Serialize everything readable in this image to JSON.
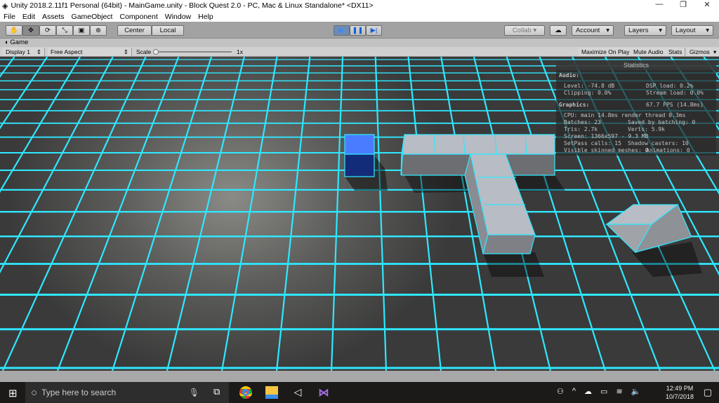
{
  "window": {
    "title": "Unity 2018.2.11f1 Personal (64bit) - MainGame.unity - Block Quest 2.0 - PC, Mac & Linux Standalone* <DX11>",
    "minimize": "—",
    "restore": "❐",
    "close": "✕"
  },
  "menu": [
    "File",
    "Edit",
    "Assets",
    "GameObject",
    "Component",
    "Window",
    "Help"
  ],
  "toolbar": {
    "tools": [
      "✋",
      "✥",
      "⟳",
      "⤡",
      "▣",
      "⊕"
    ],
    "pivot": "Center",
    "space": "Local",
    "play": "▶",
    "pause": "❚❚",
    "step": "▶|",
    "collab": "Collab",
    "cloud": "☁",
    "account": "Account",
    "layers": "Layers",
    "layout": "Layout"
  },
  "game": {
    "tab": "Game",
    "display": "Display 1",
    "aspect": "Free Aspect",
    "scale_label": "Scale",
    "scale_value": "1x",
    "maximize": "Maximize On Play",
    "mute": "Mute Audio",
    "stats": "Stats",
    "gizmos": "Gizmos"
  },
  "statistics": {
    "title": "Statistics",
    "audio": "Audio:",
    "level": "Level: -74.8 dB",
    "dsp": "DSP load: 0.2%",
    "clipping": "Clipping: 0.0%",
    "stream": "Stream load: 0.0%",
    "graphics": "Graphics:",
    "fps": "67.7 FPS (14.8ms)",
    "cpu": "CPU: main 14.8ms  render thread 0.3ms",
    "batches": "Batches: 23",
    "saved": "Saved by batching: 0",
    "tris": "Tris: 2.7k",
    "verts": "Verts: 5.9k",
    "screen": "Screen: 1366x597 - 9.3 MB",
    "setpass": "SetPass calls: 15",
    "shadow": "Shadow casters: 10",
    "skinned": "Visible skinned meshes: 0",
    "anim": "Animations: 0"
  },
  "taskbar": {
    "search_placeholder": "Type here to search",
    "time": "12:49 PM",
    "date": "10/7/2018"
  },
  "colors": {
    "grid": "#2ee8ff",
    "blue_cube": "#4a7cff",
    "block": "#b8bcc4"
  }
}
